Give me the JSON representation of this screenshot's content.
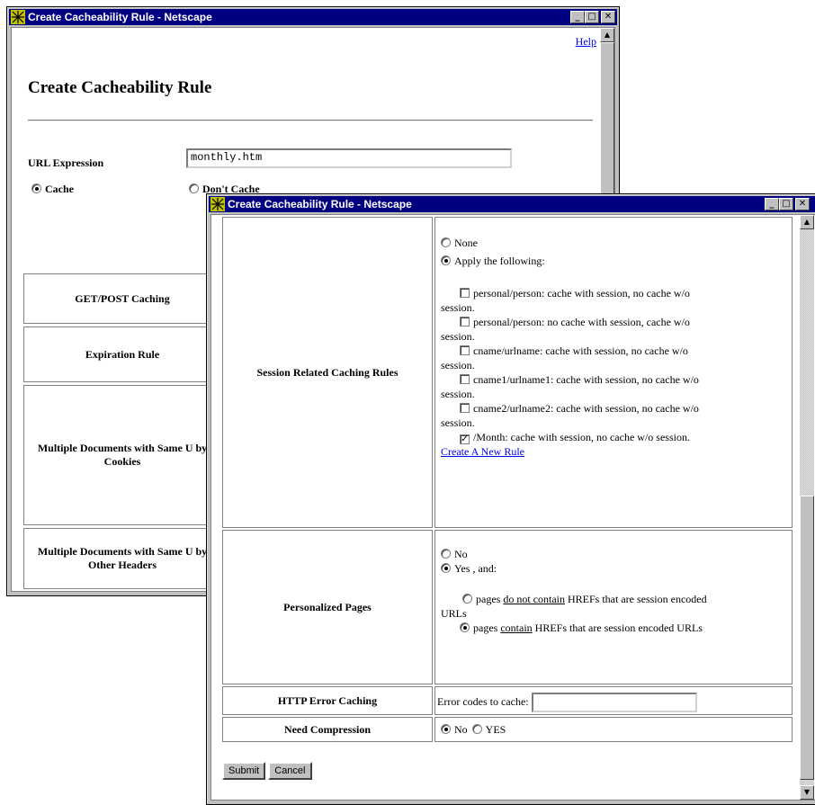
{
  "back_window": {
    "title": "Create Cacheability Rule - Netscape",
    "help_link": "Help",
    "heading": "Create Cacheability Rule",
    "url_expression_label": "URL Expression",
    "url_expression_value": "monthly.htm",
    "cache_label": "Cache",
    "dont_cache_label": "Don't Cache",
    "rows": [
      "GET/POST Caching",
      "Expiration Rule",
      "Multiple Documents with Same U by Cookies",
      "Multiple Documents with Same U by Other Headers"
    ],
    "cache_selected": true
  },
  "front_window": {
    "title": "Create Cacheability Rule - Netscape",
    "session_rules": {
      "label": "Session Related Caching Rules",
      "none_label": "None",
      "apply_label": "Apply the following:",
      "apply_selected": true,
      "rules": [
        {
          "label": "personal/person: cache with session, no cache w/o session.",
          "checked": false
        },
        {
          "label": "personal/person: no cache with session, cache w/o session.",
          "checked": false
        },
        {
          "label": "cname/urlname: cache with session, no cache w/o session.",
          "checked": false
        },
        {
          "label": "cname1/urlname1: cache with session, no cache w/o session.",
          "checked": false
        },
        {
          "label": "cname2/urlname2: cache with session, no cache w/o session.",
          "checked": false
        },
        {
          "label": "/Month: cache with session, no cache w/o session.",
          "checked": true
        }
      ],
      "new_rule_link": "Create A New Rule"
    },
    "personalized": {
      "label": "Personalized Pages",
      "no_label": "No",
      "yes_label": "Yes , and:",
      "yes_selected": true,
      "option1_pre": "pages ",
      "option1_u": "do not contain",
      "option1_post": " HREFs that are session encoded URLs",
      "option2_pre": "pages ",
      "option2_u": "contain",
      "option2_post": " HREFs that are session encoded URLs",
      "option2_selected": true
    },
    "http_error": {
      "label": "HTTP Error Caching",
      "codes_label": "Error codes to cache:",
      "codes_value": ""
    },
    "compression": {
      "label": "Need Compression",
      "no_label": "No",
      "yes_label": "YES",
      "no_selected": true
    },
    "submit_label": "Submit",
    "cancel_label": "Cancel"
  }
}
